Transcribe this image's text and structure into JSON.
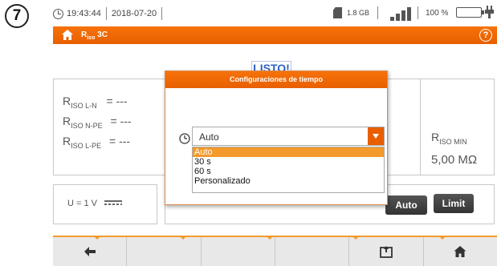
{
  "step_number": "7",
  "status": {
    "time": "19:43:44",
    "date": "2018-07-20",
    "storage": "1.8 GB",
    "battery_percent": "100 %",
    "signal_icon": "signal-icon",
    "battery_icon": "battery-icon",
    "power_icon": "power-plug-icon",
    "storage_icon": "sd-card-icon"
  },
  "header": {
    "title_main": "R",
    "title_sub": "iso",
    "title_suffix": " 3C",
    "help_label": "?",
    "home_icon": "home-icon",
    "accent_color": "#e85f00"
  },
  "measurement": {
    "status_badge": "LISTO!",
    "rows": [
      {
        "main": "R",
        "sub": "ISO L-N",
        "value": "= ---"
      },
      {
        "main": "R",
        "sub": "ISO N-PE",
        "value": "= ---"
      },
      {
        "main": "R",
        "sub": "ISO L-PE",
        "value": "= ---"
      }
    ],
    "rmin_main": "R",
    "rmin_sub": "ISO MIN",
    "rmin_value": "5,00 MΩ",
    "voltage_label": "U = 1 V"
  },
  "buttons": {
    "auto": "Auto",
    "limit": "Limit"
  },
  "dialog": {
    "title": "Configuraciones de tiempo",
    "selected_value": "Auto",
    "options": [
      "Auto",
      "30 s",
      "60 s",
      "Personalizado"
    ],
    "highlight_color": "#f39a2d"
  },
  "bottom_bar": {
    "icons": [
      "back-arrow-icon",
      "",
      "",
      "",
      "save-icon",
      "home-icon"
    ]
  }
}
